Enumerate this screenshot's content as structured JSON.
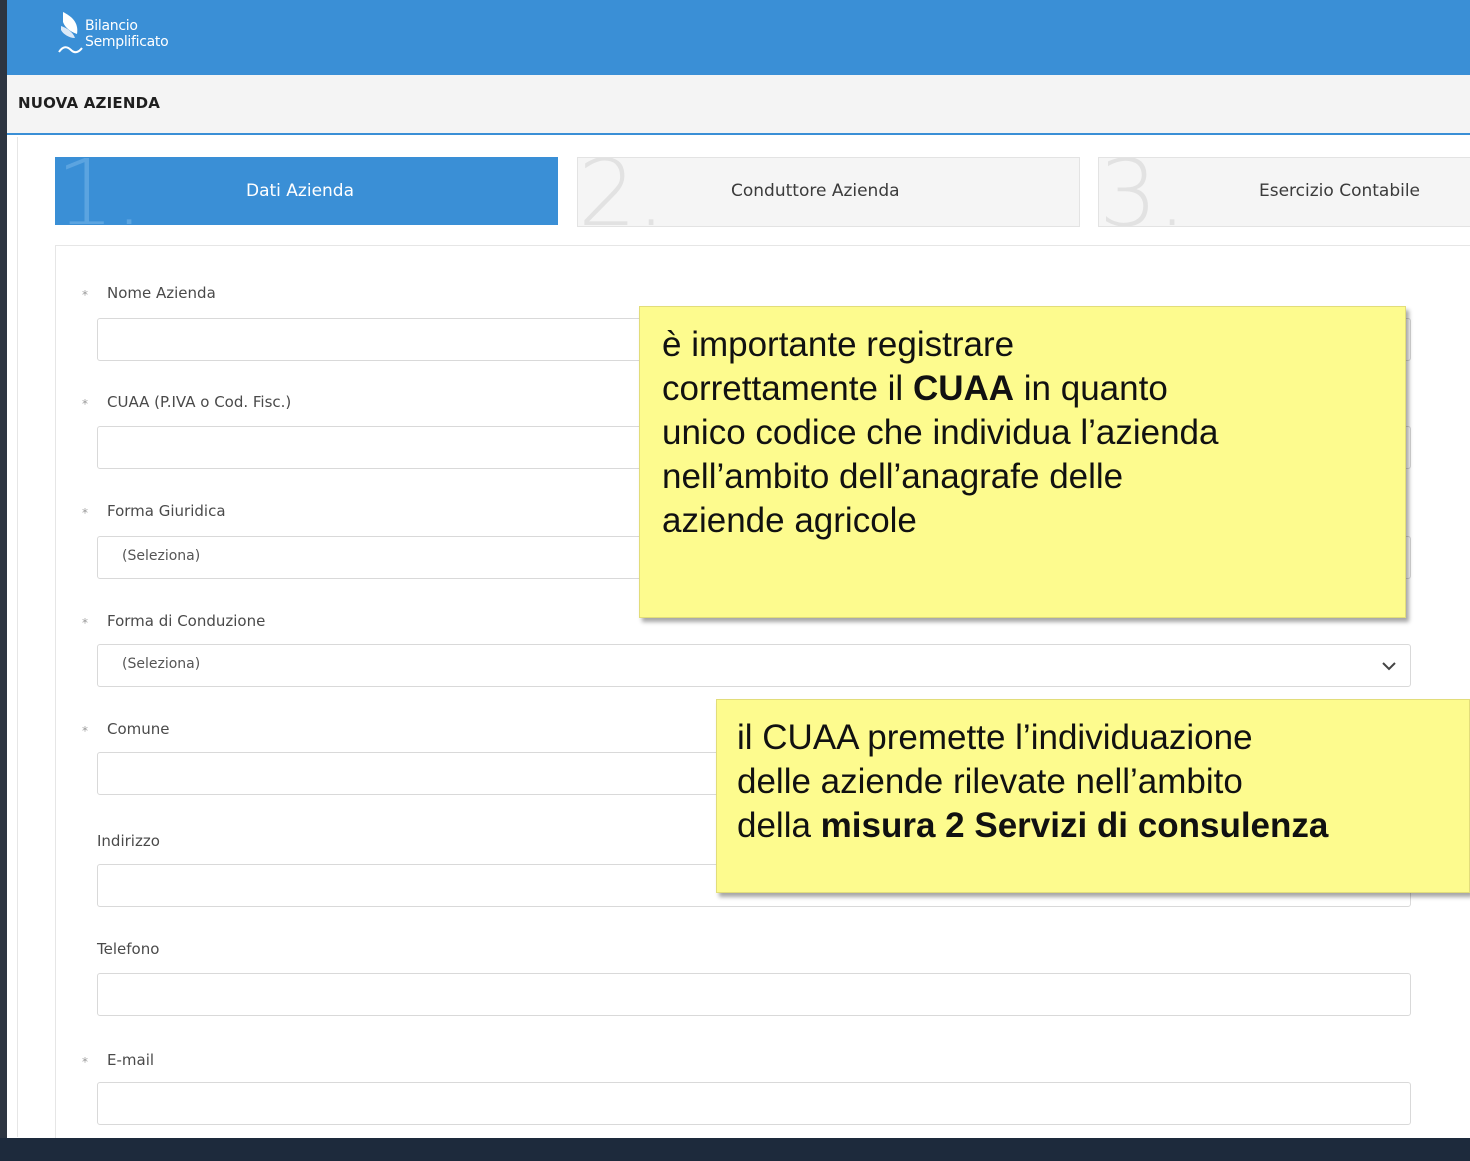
{
  "app": {
    "logo_line1": "Bilancio",
    "logo_line2": "Semplificato",
    "accent_color": "#3a8fd6",
    "callout_color": "#fdfb8e"
  },
  "page_title": "NUOVA AZIENDA",
  "steps": [
    {
      "number": "1.",
      "label": "Dati Azienda",
      "active": true
    },
    {
      "number": "2.",
      "label": "Conduttore Azienda",
      "active": false
    },
    {
      "number": "3.",
      "label": "Esercizio Contabile",
      "active": false
    }
  ],
  "form": {
    "required_marker": "*",
    "fields": [
      {
        "label": "Nome Azienda",
        "required": true,
        "value": ""
      },
      {
        "label": "CUAA (P.IVA o Cod. Fisc.)",
        "required": true,
        "value": ""
      },
      {
        "label": "Forma Giuridica",
        "required": true,
        "value": "(Seleziona)"
      },
      {
        "label": "Forma di Conduzione",
        "required": true,
        "value": "(Seleziona)"
      },
      {
        "label": "Comune",
        "required": true,
        "value": ""
      },
      {
        "label": "Indirizzo",
        "required": false,
        "value": ""
      },
      {
        "label": "Telefono",
        "required": false,
        "value": ""
      },
      {
        "label": "E-mail",
        "required": true,
        "value": ""
      }
    ]
  },
  "callouts": {
    "cuaa_note": {
      "line1": "è importante registrare",
      "line2_pre": "correttamente il ",
      "line2_bold": "CUAA",
      "line2_post": " in quanto",
      "line3": "unico codice che individua l’azienda",
      "line4": "nell’ambito dell’anagrafe delle",
      "line5": "aziende agricole"
    },
    "misura_note": {
      "line1": "il CUAA premette l’individuazione",
      "line2": "delle aziende rilevate nell’ambito",
      "line3_pre": "della ",
      "line3_bold": "misura 2 Servizi di consulenza"
    }
  }
}
